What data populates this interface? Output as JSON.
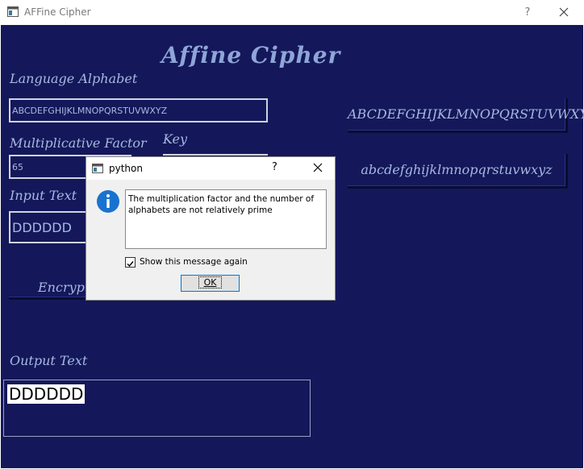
{
  "window": {
    "title": "AFFine Cipher",
    "help_label": "?"
  },
  "heading": "Affine Cipher",
  "labels": {
    "language_alphabet": "Language Alphabet",
    "multiplicative_factor": "Multiplicative Factor",
    "key": "Key",
    "input_text": "Input Text",
    "output_text": "Output Text"
  },
  "fields": {
    "alphabet_value": "ABCDEFGHIJKLMNOPQRSTUVWXYZ",
    "factor_value": "65",
    "input_value": "DDDDDD",
    "output_value": "DDDDDD"
  },
  "buttons": {
    "uppercase": "ABCDEFGHIJKLMNOPQRSTUVWXYZ",
    "lowercase": "abcdefghijklmnopqrstuvwxyz",
    "encrypt": "Encrypt"
  },
  "dialog": {
    "title": "python",
    "help_label": "?",
    "message": "The multiplication factor and the number of alphabets are not relatively prime",
    "checkbox_label": "Show this message again",
    "checkbox_checked": true,
    "ok_label": "OK"
  },
  "colors": {
    "background": "#14185a",
    "label": "#a7b8e0",
    "info_icon": "#1a72d0"
  }
}
